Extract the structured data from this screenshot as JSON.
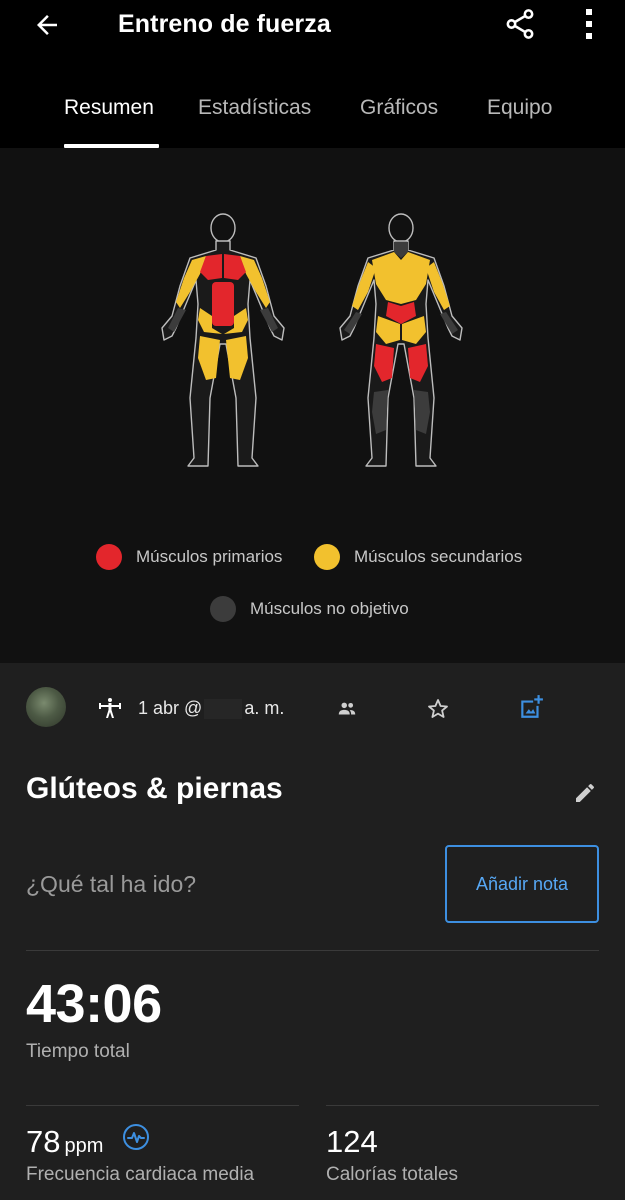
{
  "header": {
    "title": "Entreno de fuerza",
    "back_icon": "arrow-left-icon",
    "share_icon": "share-icon",
    "more_icon": "more-vert-icon"
  },
  "tabs": [
    {
      "label": "Resumen",
      "active": true
    },
    {
      "label": "Estadísticas",
      "active": false
    },
    {
      "label": "Gráficos",
      "active": false
    },
    {
      "label": "Equipo",
      "active": false
    }
  ],
  "muscle_map": {
    "legend": [
      {
        "label": "Músculos primarios",
        "color": "#e3262c"
      },
      {
        "label": "Músculos secundarios",
        "color": "#f2c12e"
      },
      {
        "label": "Músculos no objetivo",
        "color": "#3c3c3c"
      }
    ]
  },
  "meta": {
    "activity_icon": "strength-training-icon",
    "date_prefix": "1 abr @",
    "date_suffix": "a. m.",
    "people_icon": "people-icon",
    "star_icon": "star-outline-icon",
    "photo_icon": "add-photo-icon"
  },
  "workout": {
    "title": "Glúteos & piernas",
    "note_prompt": "¿Qué tal ha ido?",
    "add_note_label": "Añadir nota"
  },
  "stats": {
    "total_time": "43:06",
    "total_time_label": "Tiempo total",
    "avg_hr_value": "78",
    "avg_hr_unit": "ppm",
    "avg_hr_label": "Frecuencia cardiaca media",
    "calories_value": "124",
    "calories_label": "Calorías totales"
  },
  "colors": {
    "accent": "#3d8fe0",
    "primary_muscle": "#e3262c",
    "secondary_muscle": "#f2c12e",
    "non_target_muscle": "#3c3c3c"
  }
}
